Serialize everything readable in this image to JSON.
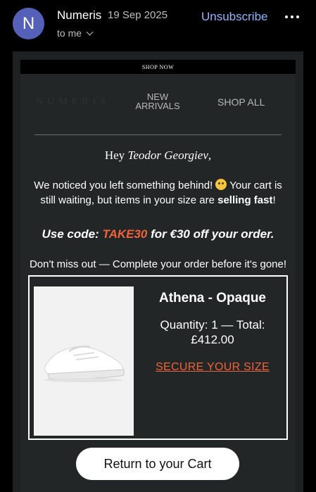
{
  "header": {
    "avatar_letter": "N",
    "sender": "Numeris",
    "date": "19 Sep 2025",
    "recipient": "to me",
    "unsubscribe": "Unsubscribe",
    "more_icon": "more-horizontal-icon"
  },
  "email": {
    "shop_now": "SHOP NOW",
    "logo_text": "NUMERIS",
    "nav": {
      "new_arrivals_line1": "NEW",
      "new_arrivals_line2": "ARRIVALS",
      "shop_all": "SHOP ALL"
    },
    "greeting_prefix": "Hey ",
    "greeting_name": "Teodor Georgiev",
    "greeting_suffix": ",",
    "notice_part1": "We noticed you left something behind! ",
    "notice_emoji": "worried-face-emoji",
    "notice_part2": " Your cart is still waiting, but items in your size are ",
    "notice_bold": "selling fast",
    "notice_end": "!",
    "code_prefix": "Use code: ",
    "code_value": "TAKE30",
    "code_suffix": " for €30 off your order.",
    "missout": "Don't miss out — Complete your order before it's gone!",
    "product": {
      "name": "Athena - Opaque",
      "quantity_line": "Quantity: 1 — Total:",
      "total": "£412.00",
      "secure_link": "SECURE YOUR SIZE",
      "image_icon": "sneaker-image"
    },
    "cta": "Return to your Cart"
  },
  "colors": {
    "avatar": "#5560b8",
    "link_blue": "#8fb4ff",
    "accent": "#f0623a",
    "email_bg": "#222627"
  }
}
